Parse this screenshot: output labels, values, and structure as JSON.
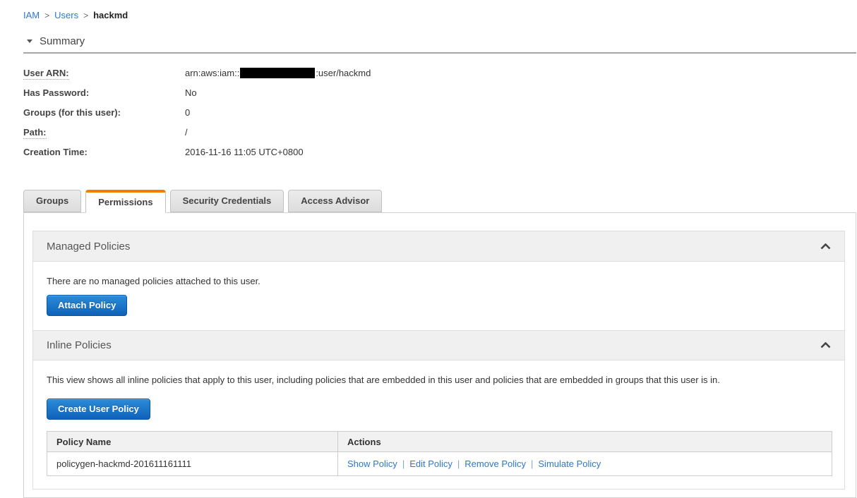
{
  "breadcrumb": {
    "separator": ">",
    "items": [
      {
        "label": "IAM"
      },
      {
        "label": "Users"
      },
      {
        "label": "hackmd"
      }
    ]
  },
  "summary": {
    "title": "Summary",
    "fields": [
      {
        "label": "User ARN:",
        "value_prefix": "arn:aws:iam::",
        "value_suffix": ":user/hackmd",
        "redacted": true
      },
      {
        "label": "Has Password:",
        "value": "No"
      },
      {
        "label": "Groups (for this user):",
        "value": "0"
      },
      {
        "label": "Path:",
        "value": "/"
      },
      {
        "label": "Creation Time:",
        "value": "2016-11-16 11:05 UTC+0800"
      }
    ]
  },
  "tabs": [
    {
      "label": "Groups",
      "active": false
    },
    {
      "label": "Permissions",
      "active": true
    },
    {
      "label": "Security Credentials",
      "active": false
    },
    {
      "label": "Access Advisor",
      "active": false
    }
  ],
  "managed_policies": {
    "title": "Managed Policies",
    "empty_text": "There are no managed policies attached to this user.",
    "attach_button": "Attach Policy"
  },
  "inline_policies": {
    "title": "Inline Policies",
    "description": "This view shows all inline policies that apply to this user, including policies that are embedded in this user and policies that are embedded in groups that this user is in.",
    "create_button": "Create User Policy",
    "table": {
      "columns": [
        "Policy Name",
        "Actions"
      ],
      "actions_separator": "|",
      "rows": [
        {
          "policy_name": "policygen-hackmd-201611161111",
          "actions": [
            "Show Policy",
            "Edit Policy",
            "Remove Policy",
            "Simulate Policy"
          ]
        }
      ]
    }
  },
  "colors": {
    "link_blue": "#2e77d0",
    "tab_accent_orange": "#ee7f01",
    "button_blue_top": "#2a8cd9",
    "button_blue_bottom": "#0f62b8",
    "section_header_gray": "#f0f0f0"
  }
}
